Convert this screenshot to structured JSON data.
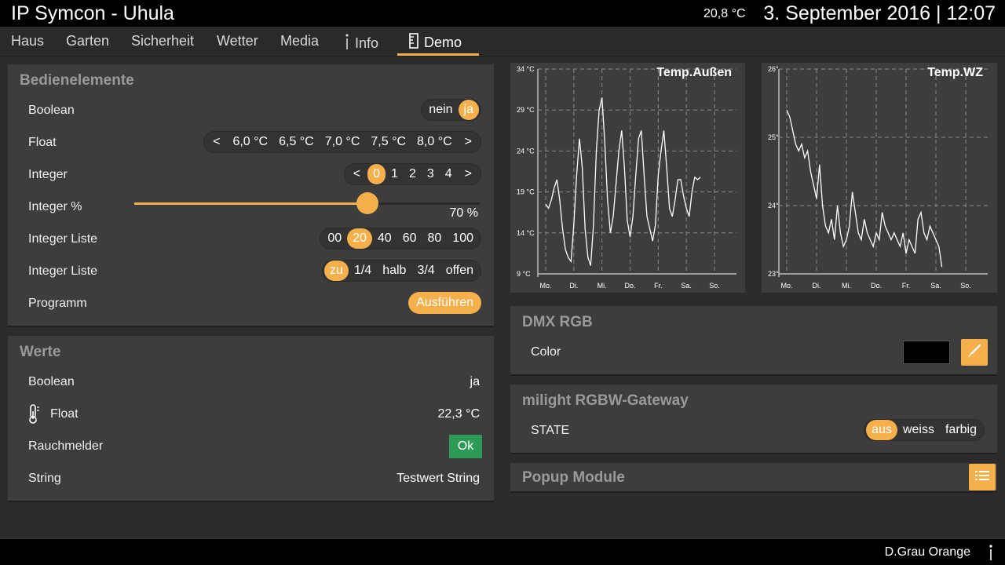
{
  "header": {
    "title": "IP Symcon - Uhula",
    "outside_temp": "20,8 °C",
    "datetime": "3. September 2016 | 12:07"
  },
  "nav": {
    "items": [
      {
        "label": "Haus"
      },
      {
        "label": "Garten"
      },
      {
        "label": "Sicherheit"
      },
      {
        "label": "Wetter"
      },
      {
        "label": "Media"
      },
      {
        "label": "Info",
        "icon": "info-icon"
      },
      {
        "label": "Demo",
        "icon": "ruler-icon",
        "active": true
      }
    ]
  },
  "bedienelemente": {
    "title": "Bedienelemente",
    "boolean": {
      "label": "Boolean",
      "options": [
        "nein",
        "ja"
      ],
      "selected": "ja"
    },
    "float": {
      "label": "Float",
      "options": [
        "<",
        "6,0 °C",
        "6,5 °C",
        "7,0 °C",
        "7,5 °C",
        "8,0 °C",
        ">"
      ]
    },
    "integer": {
      "label": "Integer",
      "options": [
        "<",
        "0",
        "1",
        "2",
        "3",
        "4",
        ">"
      ],
      "selected": "0"
    },
    "integer_pct": {
      "label": "Integer %",
      "value_text": "70 %",
      "value": 0.7
    },
    "integer_liste1": {
      "label": "Integer Liste",
      "options": [
        "00",
        "20",
        "40",
        "60",
        "80",
        "100"
      ],
      "selected": "20"
    },
    "integer_liste2": {
      "label": "Integer Liste",
      "options": [
        "zu",
        "1/4",
        "halb",
        "3/4",
        "offen"
      ],
      "selected": "zu"
    },
    "programm": {
      "label": "Programm",
      "button": "Ausführen"
    }
  },
  "werte": {
    "title": "Werte",
    "boolean": {
      "label": "Boolean",
      "value": "ja"
    },
    "float": {
      "label": "Float",
      "value": "22,3 °C",
      "icon": "thermometer-icon"
    },
    "rauchmelder": {
      "label": "Rauchmelder",
      "value": "Ok"
    },
    "string": {
      "label": "String",
      "value": "Testwert String"
    }
  },
  "dmx": {
    "title": "DMX RGB",
    "color_label": "Color",
    "color_value": "#000000"
  },
  "milight": {
    "title": "milight RGBW-Gateway",
    "state_label": "STATE",
    "options": [
      "aus",
      "weiss",
      "farbig"
    ],
    "selected": "aus"
  },
  "popup": {
    "title": "Popup Module"
  },
  "footer": {
    "text": "D.Grau  Orange"
  },
  "colors": {
    "accent": "#f5b04b",
    "ok": "#2d9b57",
    "panel": "#3d3d3d",
    "background": "#2c2c2c"
  },
  "chart_data": [
    {
      "type": "line",
      "title": "Temp.Außen",
      "x_ticks": [
        "Mo.",
        "Di.",
        "Mi.",
        "Do.",
        "Fr.",
        "Sa.",
        "So."
      ],
      "y_ticks": [
        "9 °C",
        "14 °C",
        "19 °C",
        "24 °C",
        "29 °C",
        "34 °C"
      ],
      "ylim": [
        9,
        34
      ],
      "xlim": [
        0,
        6
      ],
      "grid": true,
      "series": [
        {
          "x": [
            0,
            0.1,
            0.2,
            0.3,
            0.4,
            0.5,
            0.6,
            0.7,
            0.8,
            0.9,
            1.0,
            1.1,
            1.2,
            1.3,
            1.4,
            1.5,
            1.6,
            1.7,
            1.8,
            1.9,
            2.0,
            2.1,
            2.2,
            2.3,
            2.4,
            2.5,
            2.6,
            2.7,
            2.8,
            2.9,
            3.0,
            3.1,
            3.2,
            3.3,
            3.4,
            3.5,
            3.6,
            3.7,
            3.8,
            3.9,
            4.0,
            4.1,
            4.2,
            4.3,
            4.4,
            4.5,
            4.6,
            4.7,
            4.8,
            4.9,
            5.0,
            5.1,
            5.2,
            5.3,
            5.4,
            5.5
          ],
          "y": [
            17.5,
            17.0,
            18.0,
            19.5,
            20.5,
            18.0,
            14.5,
            12.0,
            11.0,
            10.5,
            15.0,
            21.0,
            25.5,
            22.0,
            14.5,
            11.0,
            10.0,
            15.0,
            24.0,
            29.0,
            30.5,
            25.0,
            18.0,
            14.0,
            16.0,
            20.0,
            24.0,
            26.5,
            22.0,
            15.5,
            13.5,
            16.0,
            21.0,
            25.5,
            26.5,
            21.0,
            16.0,
            14.5,
            13.0,
            15.0,
            21.0,
            24.0,
            26.5,
            22.0,
            17.0,
            16.0,
            18.0,
            20.5,
            20.5,
            18.5,
            17.0,
            16.0,
            19.0,
            20.8,
            20.5,
            20.8
          ]
        }
      ]
    },
    {
      "type": "line",
      "title": "Temp.WZ",
      "x_ticks": [
        "Mo.",
        "Di.",
        "Mi.",
        "Do.",
        "Fr.",
        "Sa.",
        "So."
      ],
      "y_ticks": [
        "23°",
        "24°",
        "25°",
        "26°"
      ],
      "ylim": [
        23,
        26
      ],
      "xlim": [
        0,
        6
      ],
      "grid": true,
      "series": [
        {
          "x": [
            0,
            0.1,
            0.2,
            0.3,
            0.4,
            0.5,
            0.6,
            0.7,
            0.8,
            0.9,
            1.0,
            1.1,
            1.2,
            1.3,
            1.4,
            1.5,
            1.6,
            1.7,
            1.8,
            1.9,
            2.0,
            2.1,
            2.2,
            2.3,
            2.4,
            2.5,
            2.6,
            2.7,
            2.8,
            2.9,
            3.0,
            3.1,
            3.2,
            3.3,
            3.4,
            3.5,
            3.6,
            3.7,
            3.8,
            3.9,
            4.0,
            4.1,
            4.2,
            4.3,
            4.4,
            4.5,
            4.6,
            4.7,
            4.8,
            4.9,
            5.0,
            5.1,
            5.2
          ],
          "y": [
            25.4,
            25.3,
            25.1,
            24.9,
            24.8,
            24.9,
            24.7,
            24.8,
            24.5,
            24.3,
            24.1,
            24.6,
            24.0,
            23.7,
            23.6,
            23.8,
            23.5,
            24.0,
            23.6,
            23.4,
            23.5,
            23.7,
            24.2,
            23.9,
            23.6,
            23.5,
            23.8,
            23.6,
            23.5,
            23.4,
            23.6,
            23.5,
            23.9,
            23.7,
            23.6,
            23.5,
            23.6,
            23.5,
            23.4,
            23.6,
            23.3,
            23.5,
            23.4,
            23.3,
            23.8,
            23.9,
            23.6,
            23.5,
            23.7,
            23.6,
            23.5,
            23.4,
            23.1
          ]
        }
      ]
    }
  ]
}
